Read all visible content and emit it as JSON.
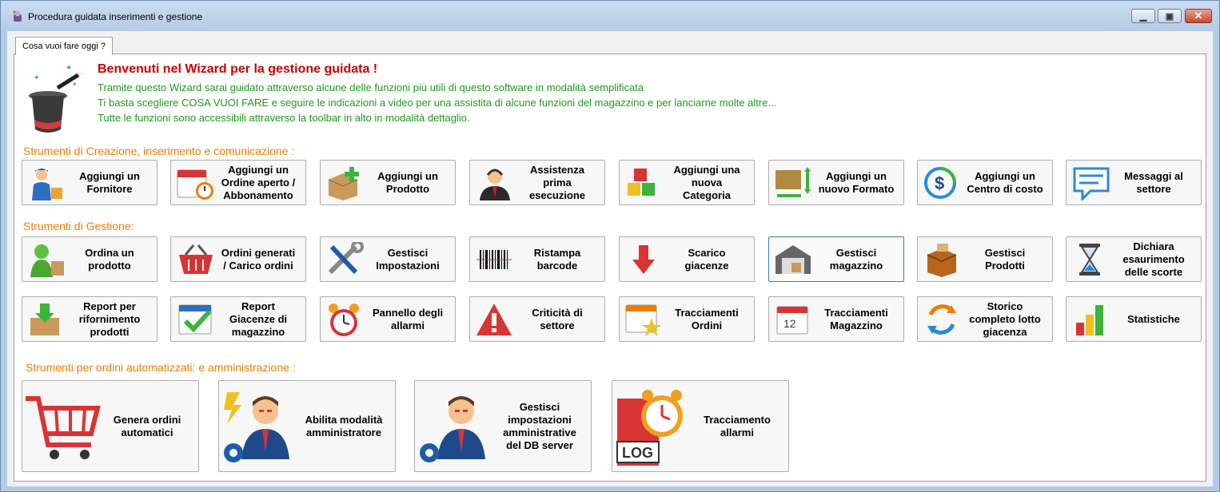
{
  "window": {
    "title": "Procedura guidata inserimenti e gestione",
    "min_glyph": "▁",
    "max_glyph": "▣",
    "close_glyph": "✕"
  },
  "tab": {
    "label": "Cosa vuoi fare oggi ?"
  },
  "welcome": {
    "title": "Benvenuti nel Wizard per la gestione guidata !",
    "lines": [
      "Tramite questo Wizard sarai guidato attraverso alcune delle funzioni più utili di questo software in modalità semplificata",
      "Ti basta scegliere COSA VUOI FARE e seguire le indicazioni a video per una assistita di alcune funzioni del magazzino e per lanciarne molte altre...",
      "Tutte le funzioni sono accessibili attraverso la toolbar in alto in modalità dettaglio."
    ]
  },
  "sections": {
    "creation": "Strumenti di Creazione, inserimento e comunicazione :",
    "management": "Strumenti di Gestione:",
    "automation": "Strumenti per ordini automatizzati: e amministrazione :"
  },
  "creation_buttons": [
    {
      "label": "Aggiungi un\nFornitore",
      "icon": "courier-icon"
    },
    {
      "label": "Aggiungi un\nOrdine aperto /\nAbbonamento",
      "icon": "calendar-clock-icon"
    },
    {
      "label": "Aggiungi un\nProdotto",
      "icon": "box-add-icon"
    },
    {
      "label": "Assistenza\nprima\nesecuzione",
      "icon": "support-agent-icon"
    },
    {
      "label": "Aggiungi una\nnuova\nCategoria",
      "icon": "cubes-icon"
    },
    {
      "label": "Aggiungi un\nnuovo Formato",
      "icon": "resize-box-icon"
    },
    {
      "label": "Aggiungi un\nCentro di costo",
      "icon": "dollar-cycle-icon"
    },
    {
      "label": "Messaggi al\nsettore",
      "icon": "message-icon"
    }
  ],
  "management_row1": [
    {
      "label": "Ordina un\nprodotto",
      "icon": "shopping-user-icon"
    },
    {
      "label": "Ordini generati\n/ Carico ordini",
      "icon": "basket-icon"
    },
    {
      "label": "Gestisci\nImpostazioni",
      "icon": "tools-icon"
    },
    {
      "label": "Ristampa\nbarcode",
      "icon": "barcode-icon"
    },
    {
      "label": "Scarico\ngiacenze",
      "icon": "arrow-down-icon"
    },
    {
      "label": "Gestisci\nmagazzino",
      "icon": "warehouse-icon"
    },
    {
      "label": "Gestisci\nProdotti",
      "icon": "boxes-icon"
    },
    {
      "label": "Dichiara\nesaurimento\ndelle scorte",
      "icon": "hourglass-icon"
    }
  ],
  "management_row2": [
    {
      "label": "Report per\nrifornimento\nprodotti",
      "icon": "box-download-icon"
    },
    {
      "label": "Report\nGiacenze di\nmagazzino",
      "icon": "calendar-check-icon"
    },
    {
      "label": "Pannello degli\nallarmi",
      "icon": "alarm-clock-icon"
    },
    {
      "label": "Criticità di\nsettore",
      "icon": "warning-icon"
    },
    {
      "label": "Tracciamenti\nOrdini",
      "icon": "calendar-star-icon"
    },
    {
      "label": "Tracciamenti\nMagazzino",
      "icon": "calendar-12-icon"
    },
    {
      "label": "Storico\ncompleto lotto\ngiacenza",
      "icon": "refresh-arrows-icon"
    },
    {
      "label": "Statistiche",
      "icon": "bar-chart-icon"
    }
  ],
  "automation_buttons": [
    {
      "label": "Genera ordini\nautomatici",
      "icon": "cart-icon"
    },
    {
      "label": "Abilita modalità\namministratore",
      "icon": "admin-lightning-icon"
    },
    {
      "label": "Gestisci\nimpostazioni\namministrative\ndel DB server",
      "icon": "admin-gear-icon"
    },
    {
      "label": "Tracciamento\nallarmi",
      "icon": "alarm-log-icon"
    }
  ],
  "log_badge": "LOG",
  "calendar_day": "12",
  "colors": {
    "title_red": "#cc0000",
    "text_green": "#1e9a1e",
    "section_orange": "#f07c00"
  }
}
